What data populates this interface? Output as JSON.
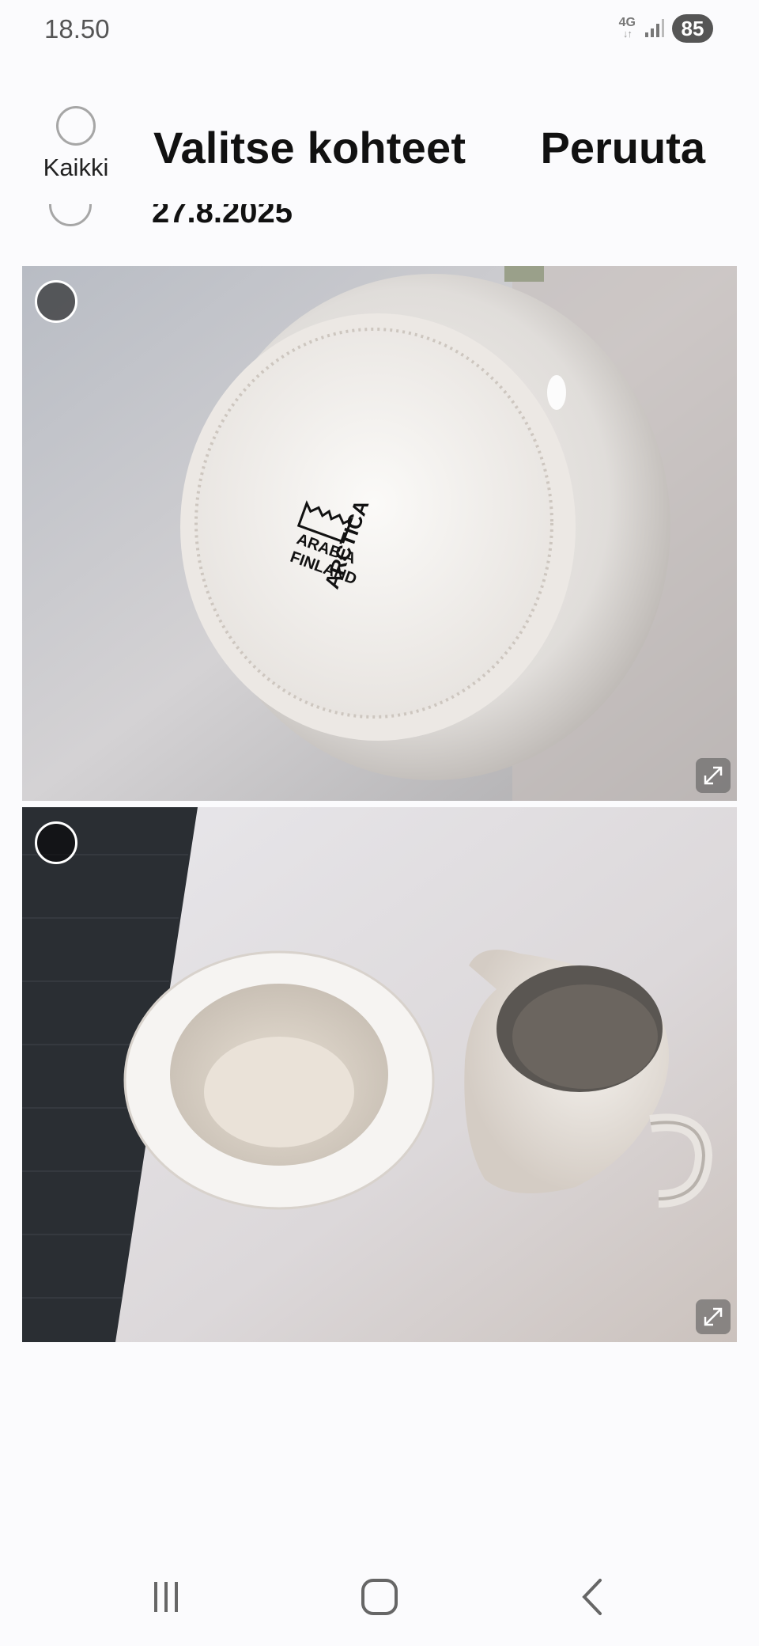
{
  "status_bar": {
    "time": "18.50",
    "network": "4G",
    "battery": "85"
  },
  "header": {
    "select_all_label": "Kaikki",
    "title": "Valitse kohteet",
    "cancel_label": "Peruuta"
  },
  "date_group": {
    "date": "27.8.2025"
  },
  "photos": [
    {
      "stamp_brand": "ARABIA",
      "stamp_country": "FINLAND",
      "stamp_series": "ARCTICA"
    },
    {}
  ],
  "icons": {
    "expand": "expand-icon",
    "recents": "recent-apps-icon",
    "home": "home-icon",
    "back": "back-icon"
  }
}
